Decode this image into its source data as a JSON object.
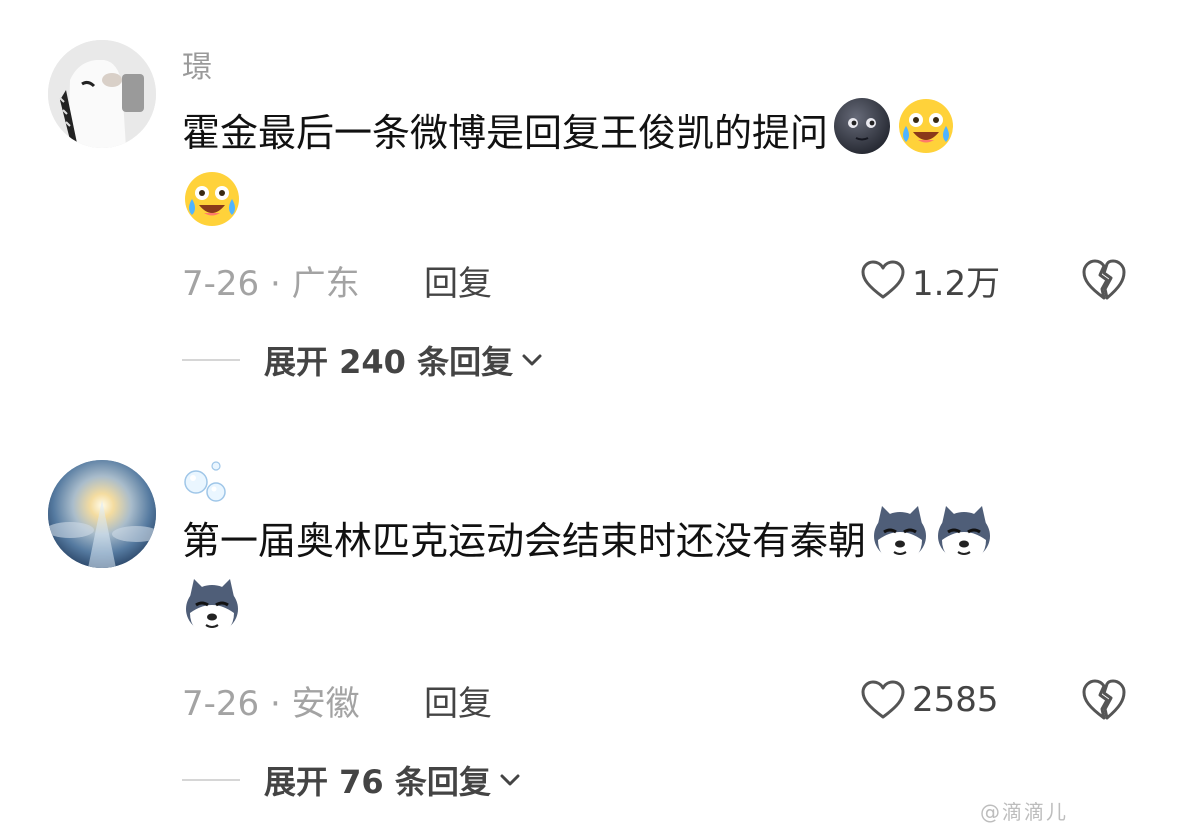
{
  "comments": [
    {
      "username": "璟",
      "text": "霍金最后一条微博是回复王俊凯的提问",
      "emojis_inline": [
        "dark-moon-face-icon",
        "crying-laughing-face-icon"
      ],
      "emojis_wrap": [
        "crying-laughing-face-icon"
      ],
      "date_location": "7-26 · 广东",
      "reply_label": "回复",
      "likes": "1.2万",
      "expand_label": "展开 240 条回复"
    },
    {
      "username": "",
      "username_icon": "bubbles-icon",
      "text": "第一届奥林匹克运动会结束时还没有秦朝",
      "emojis_inline": [
        "husky-dog-face-icon",
        "husky-dog-face-icon"
      ],
      "emojis_wrap": [
        "husky-dog-face-icon"
      ],
      "date_location": "7-26 · 安徽",
      "reply_label": "回复",
      "likes": "2585",
      "expand_label": "展开 76 条回复"
    }
  ],
  "watermark": "@滴滴儿",
  "colors": {
    "username": "#9a9a9a",
    "text": "#111111",
    "meta": "#a3a3a3",
    "action": "#444444"
  }
}
